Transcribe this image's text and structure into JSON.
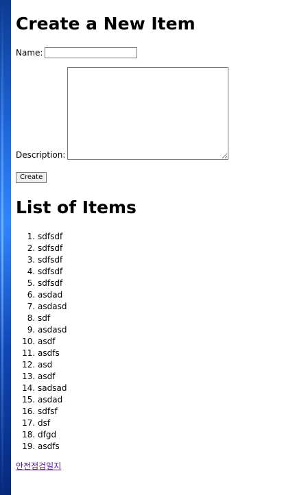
{
  "create_section": {
    "title": "Create a New Item",
    "name_label": "Name:",
    "name_value": "",
    "description_label": "Description:",
    "description_value": "",
    "create_button_label": "Create"
  },
  "list_section": {
    "title": "List of Items",
    "items": [
      "sdfsdf",
      "sdfsdf",
      "sdfsdf",
      "sdfsdf",
      "sdfsdf",
      "asdad",
      "asdasd",
      "sdf",
      "asdasd",
      "asdf",
      "asdfs",
      "asd",
      "asdf",
      "sadsad",
      "asdad",
      "sdfsf",
      "dsf",
      "dfgd",
      "asdfs"
    ]
  },
  "footer": {
    "link_label": "안전점검일지",
    "link_color": "#551a8b"
  }
}
